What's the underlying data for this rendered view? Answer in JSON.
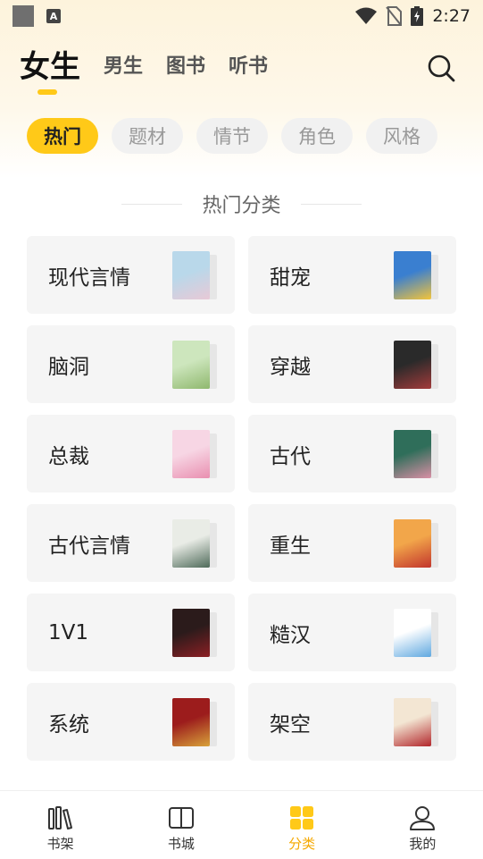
{
  "status_bar": {
    "time": "2:27"
  },
  "top_tabs": [
    {
      "label": "女生",
      "active": true
    },
    {
      "label": "男生",
      "active": false
    },
    {
      "label": "图书",
      "active": false
    },
    {
      "label": "听书",
      "active": false
    }
  ],
  "chips": [
    {
      "label": "热门",
      "active": true
    },
    {
      "label": "题材",
      "active": false
    },
    {
      "label": "情节",
      "active": false
    },
    {
      "label": "角色",
      "active": false
    },
    {
      "label": "风格",
      "active": false
    }
  ],
  "section": {
    "title": "热门分类"
  },
  "categories": [
    {
      "label": "现代言情",
      "cover_colors": [
        "#b9d8ea",
        "#e8c9d6"
      ]
    },
    {
      "label": "甜宠",
      "cover_colors": [
        "#3a7fd0",
        "#f3c43a"
      ]
    },
    {
      "label": "脑洞",
      "cover_colors": [
        "#cde6bd",
        "#8fb86e"
      ]
    },
    {
      "label": "穿越",
      "cover_colors": [
        "#2a2a2a",
        "#a33b3b"
      ]
    },
    {
      "label": "总裁",
      "cover_colors": [
        "#f7d6e4",
        "#e98fb0"
      ]
    },
    {
      "label": "古代",
      "cover_colors": [
        "#2f6e5a",
        "#d98fa5"
      ]
    },
    {
      "label": "古代言情",
      "cover_colors": [
        "#e9ece6",
        "#4f6b5a"
      ]
    },
    {
      "label": "重生",
      "cover_colors": [
        "#f2a64a",
        "#c2352c"
      ]
    },
    {
      "label": "1V1",
      "cover_colors": [
        "#2b1b1b",
        "#8c1f24"
      ]
    },
    {
      "label": "糙汉",
      "cover_colors": [
        "#ffffff",
        "#5fa8e0"
      ]
    },
    {
      "label": "系统",
      "cover_colors": [
        "#9c1c1c",
        "#d8a23a"
      ]
    },
    {
      "label": "架空",
      "cover_colors": [
        "#f3e6d3",
        "#b2262b"
      ]
    }
  ],
  "bottom_nav": [
    {
      "label": "书架",
      "active": false
    },
    {
      "label": "书城",
      "active": false
    },
    {
      "label": "分类",
      "active": true
    },
    {
      "label": "我的",
      "active": false
    }
  ],
  "colors": {
    "accent": "#ffc918",
    "accent_text": "#f5a800"
  }
}
